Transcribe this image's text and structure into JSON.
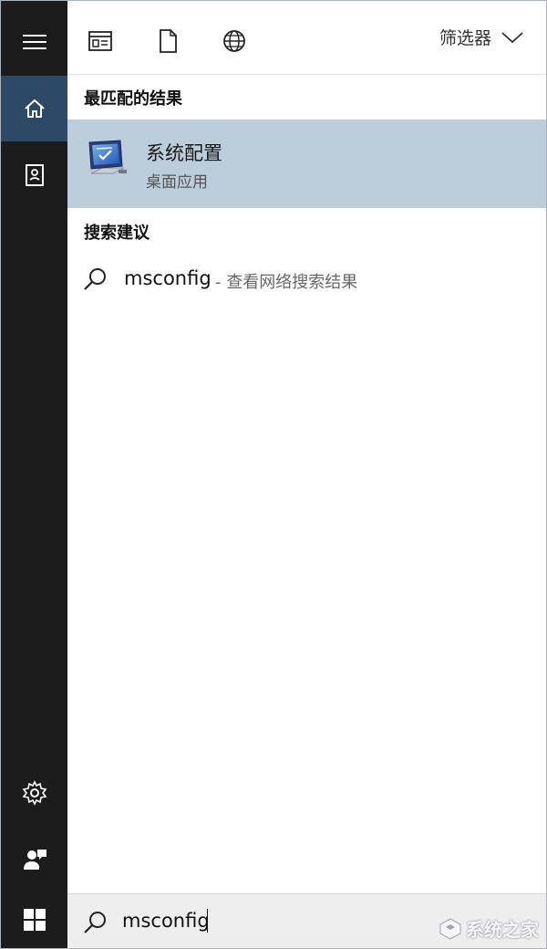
{
  "toolbar": {
    "filter_label": "筛选器",
    "icons": [
      "apps-icon",
      "document-icon",
      "globe-icon",
      "chevron-down-icon"
    ]
  },
  "rail": {
    "items": [
      "hamburger-menu-icon",
      "home-icon",
      "notebook-icon",
      "settings-icon",
      "feedback-icon",
      "windows-start-icon"
    ]
  },
  "best_match": {
    "heading": "最匹配的结果",
    "app_name": "系统配置",
    "app_type": "桌面应用",
    "icon": "system-configuration-icon"
  },
  "suggestions": {
    "heading": "搜索建议",
    "items": [
      {
        "term": "msconfig",
        "hint": "- 查看网络搜索结果"
      }
    ]
  },
  "search": {
    "value": "msconfig"
  },
  "watermark": {
    "text": "系统之家"
  },
  "colors": {
    "rail_bg": "#1c1c1c",
    "rail_active": "#2c4a66",
    "selected_result": "#bccddc",
    "search_bg": "#eeeeee"
  }
}
